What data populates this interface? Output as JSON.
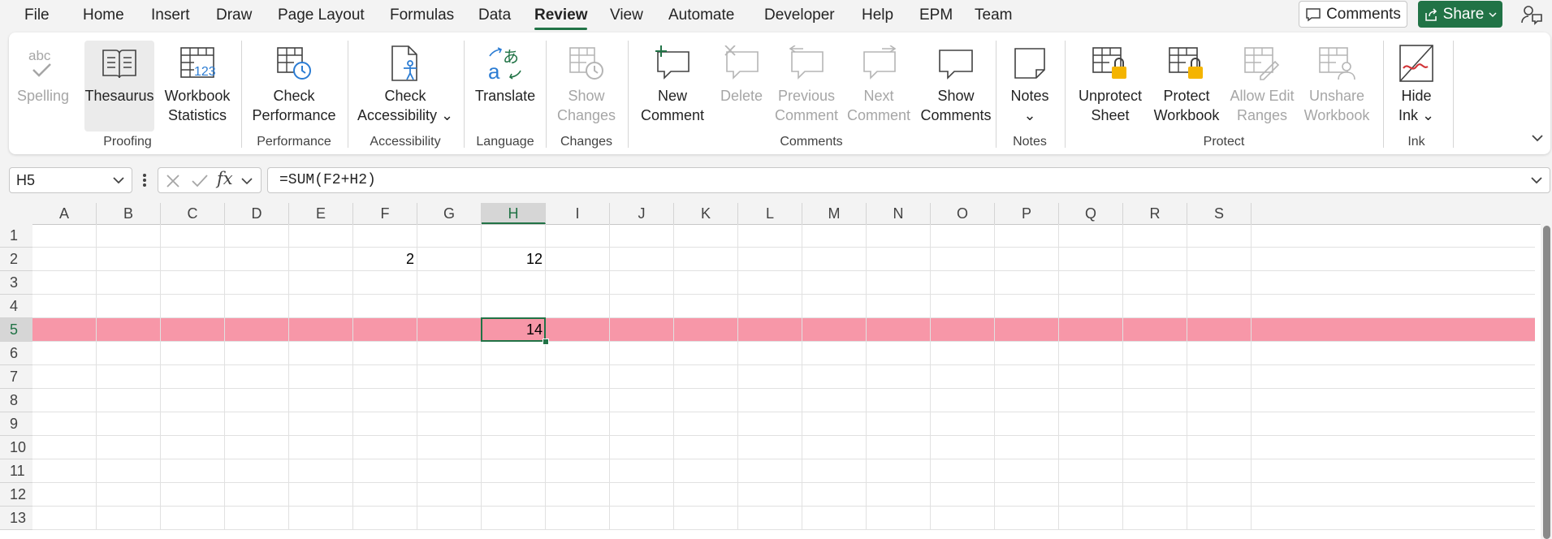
{
  "menu": {
    "items": [
      "File",
      "Home",
      "Insert",
      "Draw",
      "Page Layout",
      "Formulas",
      "Data",
      "Review",
      "View",
      "Automate",
      "Developer",
      "Help",
      "EPM",
      "Team"
    ],
    "active": "Review",
    "comments_label": "Comments",
    "share_label": "Share"
  },
  "ribbon": {
    "groups": {
      "proofing": "Proofing",
      "performance": "Performance",
      "accessibility": "Accessibility",
      "language": "Language",
      "changes": "Changes",
      "comments": "Comments",
      "notes": "Notes",
      "protect": "Protect",
      "ink": "Ink"
    },
    "buttons": {
      "spelling": "Spelling",
      "thesaurus": "Thesaurus",
      "workbook_statistics_1": "Workbook",
      "workbook_statistics_2": "Statistics",
      "check_performance_1": "Check",
      "check_performance_2": "Performance",
      "check_accessibility_1": "Check",
      "check_accessibility_2": "Accessibility ⌄",
      "translate": "Translate",
      "show_changes_1": "Show",
      "show_changes_2": "Changes",
      "new_comment_1": "New",
      "new_comment_2": "Comment",
      "delete": "Delete",
      "previous_comment_1": "Previous",
      "previous_comment_2": "Comment",
      "next_comment_1": "Next",
      "next_comment_2": "Comment",
      "show_comments_1": "Show",
      "show_comments_2": "Comments",
      "notes_1": "Notes",
      "notes_2": "⌄",
      "unprotect_sheet_1": "Unprotect",
      "unprotect_sheet_2": "Sheet",
      "protect_workbook_1": "Protect",
      "protect_workbook_2": "Workbook",
      "allow_edit_ranges_1": "Allow Edit",
      "allow_edit_ranges_2": "Ranges",
      "unshare_workbook_1": "Unshare",
      "unshare_workbook_2": "Workbook",
      "hide_ink_1": "Hide",
      "hide_ink_2": "Ink ⌄"
    }
  },
  "formula_bar": {
    "name_box": "H5",
    "formula": "=SUM(F2+H2)"
  },
  "sheet": {
    "columns": [
      "A",
      "B",
      "C",
      "D",
      "E",
      "F",
      "G",
      "H",
      "I",
      "J",
      "K",
      "L",
      "M",
      "N",
      "O",
      "P",
      "Q",
      "R",
      "S"
    ],
    "rows": [
      "1",
      "2",
      "3",
      "4",
      "5",
      "6",
      "7",
      "8",
      "9",
      "10",
      "11",
      "12",
      "13"
    ],
    "active_column": "H",
    "active_row": "5",
    "cells": {
      "F2": "2",
      "H2": "12",
      "H5": "14"
    },
    "highlight_color": "#f797a8",
    "accent": "#217346"
  }
}
